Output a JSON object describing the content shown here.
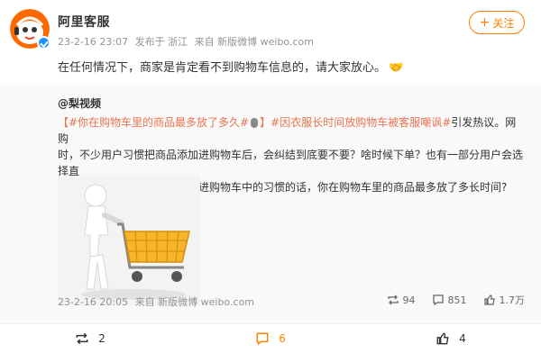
{
  "post": {
    "author": "阿里客服",
    "time": "23-2-16 23:07",
    "published_from": "发布于 浙江",
    "via": "来自 新版微博 weibo.com",
    "follow_label": "关注",
    "text": "在任何情况下，商家是肯定看不到购物车信息的，请大家放心。"
  },
  "retweet": {
    "author": "@梨视频",
    "hashtag1": "【#你在购物车里的商品最多放了多久#",
    "after_mic": "】",
    "hashtag2": "#因衣服长时间放购物车被客服嘲讽#",
    "line1_tail": "引发热议。网购",
    "line2": "时，不少用户习惯把商品添加进购物车后，会纠结到底要不要？啥时候下单？也有一部分用户会选择直",
    "line3": "接购买。如果你有将商品添加进购物车中的习惯的话，你在购物车里的商品最多放了多长时间?",
    "time": "23-2-16 20:05",
    "via": "来自 新版微博 weibo.com",
    "reposts": "94",
    "comments": "851",
    "likes": "1.7万"
  },
  "footer": {
    "reposts": "2",
    "comments": "6",
    "likes": "4"
  },
  "colors": {
    "accent": "#ff8200",
    "hashtag": "#eb7350",
    "verified": "#1e90ff"
  },
  "icons": [
    "avatar-mascot",
    "verified-badge",
    "handshake-emoji",
    "mic-icon",
    "repost-icon",
    "comment-icon",
    "like-icon"
  ]
}
